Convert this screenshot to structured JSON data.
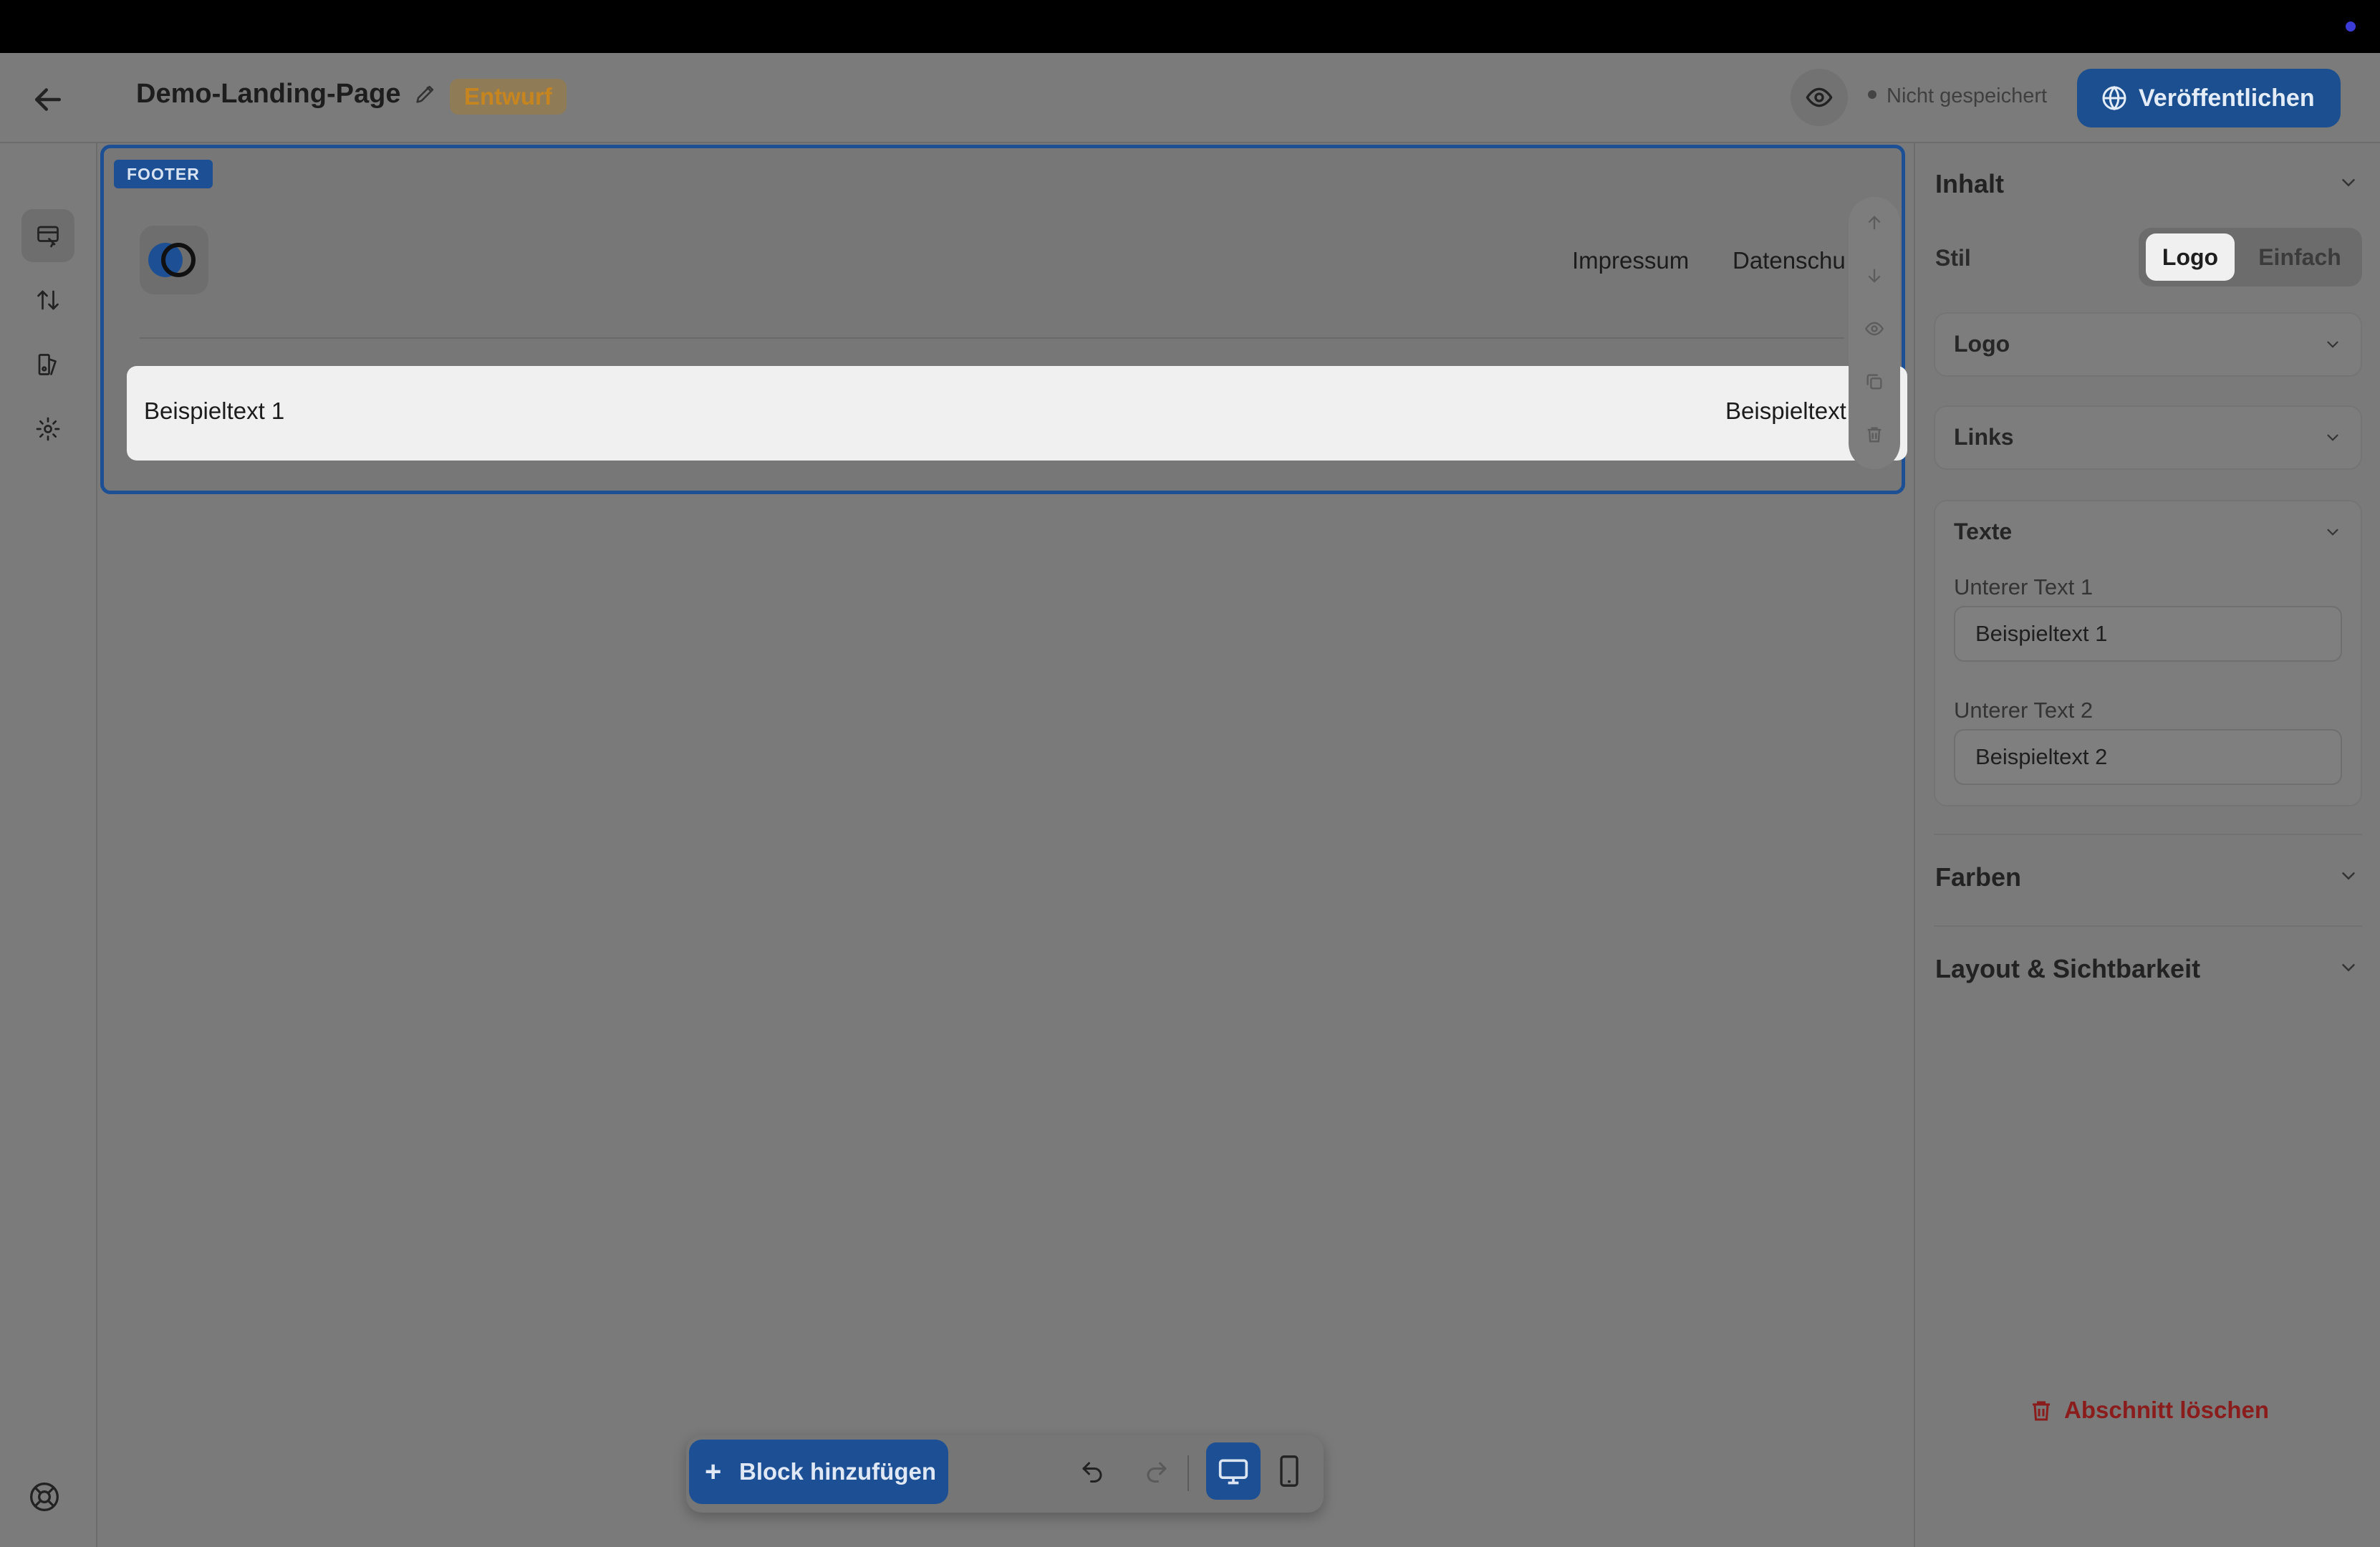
{
  "header": {
    "back_icon": "arrow-left-icon",
    "page_title": "Demo-Landing-Page",
    "edit_icon": "pencil-icon",
    "draft_badge": "Entwurf",
    "preview_icon": "eye-icon",
    "save_status": "Nicht gespeichert",
    "publish_label": "Veröffentlichen",
    "publish_icon": "globe-icon"
  },
  "left_rail": {
    "items": [
      {
        "name": "sections-icon",
        "active": true
      },
      {
        "name": "sort-icon",
        "active": false
      },
      {
        "name": "theme-icon",
        "active": false
      },
      {
        "name": "settings-icon",
        "active": false
      }
    ],
    "help_icon": "lifebuoy-icon"
  },
  "canvas": {
    "block_tag": "FOOTER",
    "nav_links": [
      "Impressum",
      "Datenschu"
    ],
    "bottom_text_1": "Beispieltext 1",
    "bottom_text_2": "Beispieltext",
    "block_tools": [
      "arrow-up-icon",
      "arrow-down-icon",
      "eye-icon",
      "copy-icon",
      "trash-icon"
    ]
  },
  "bottom_toolbar": {
    "add_block_label": "Block hinzufügen",
    "undo_icon": "undo-icon",
    "redo_icon": "redo-icon",
    "desktop_icon": "monitor-icon",
    "mobile_icon": "phone-icon"
  },
  "panel": {
    "content_title": "Inhalt",
    "style_label": "Stil",
    "style_options": [
      "Logo",
      "Einfach"
    ],
    "style_selected": "Logo",
    "logo_card": "Logo",
    "links_card": "Links",
    "texts_card": "Texte",
    "lower_text_1_label": "Unterer Text 1",
    "lower_text_1_value": "Beispieltext 1",
    "lower_text_2_label": "Unterer Text 2",
    "lower_text_2_value": "Beispieltext 2",
    "colors_title": "Farben",
    "layout_title": "Layout & Sichtbarkeit",
    "delete_label": "Abschnitt löschen"
  },
  "colors": {
    "accent": "#1c4f93",
    "draft": "#c7851f",
    "danger": "#8a1c1c"
  }
}
